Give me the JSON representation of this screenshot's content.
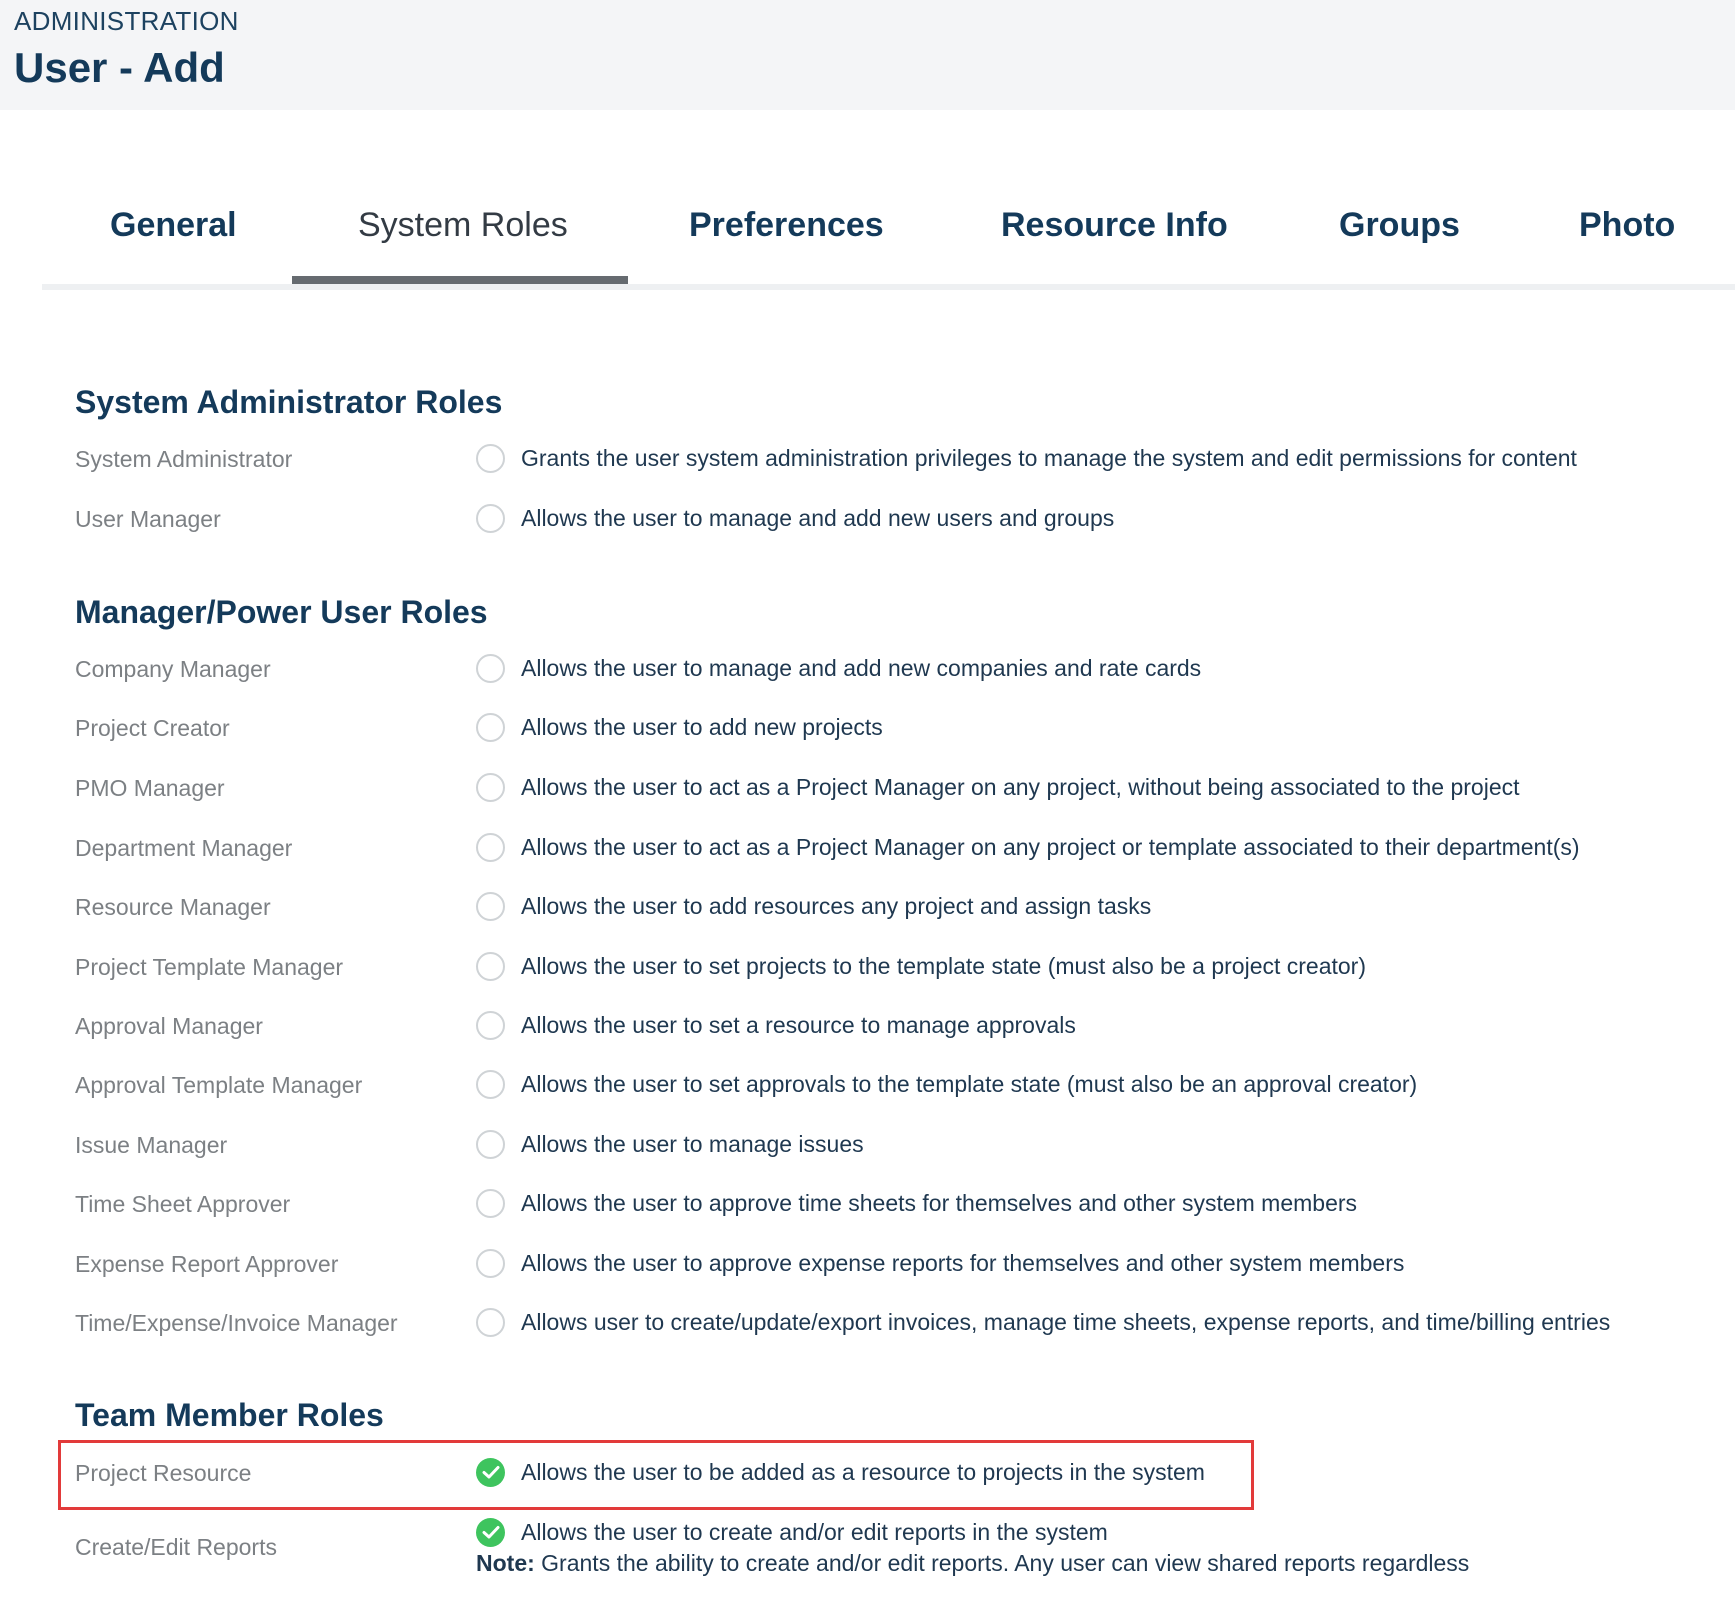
{
  "header": {
    "breadcrumb": "ADMINISTRATION",
    "title": "User - Add"
  },
  "tabs": [
    {
      "label": "General",
      "active": false
    },
    {
      "label": "System Roles",
      "active": true
    },
    {
      "label": "Preferences",
      "active": false
    },
    {
      "label": "Resource Info",
      "active": false
    },
    {
      "label": "Groups",
      "active": false
    },
    {
      "label": "Photo",
      "active": false
    }
  ],
  "sections": {
    "admin": {
      "title": "System Administrator Roles",
      "roles": [
        {
          "label": "System Administrator",
          "description": "Grants the user system administration privileges to manage the system and edit permissions for content",
          "checked": false
        },
        {
          "label": "User Manager",
          "description": "Allows the user to manage and add new users and groups",
          "checked": false
        }
      ]
    },
    "manager": {
      "title": "Manager/Power User Roles",
      "roles": [
        {
          "label": "Company Manager",
          "description": "Allows the user to manage and add new companies and rate cards",
          "checked": false
        },
        {
          "label": "Project Creator",
          "description": "Allows the user to add new projects",
          "checked": false
        },
        {
          "label": "PMO Manager",
          "description": "Allows the user to act as a Project Manager on any project, without being associated to the project",
          "checked": false
        },
        {
          "label": "Department Manager",
          "description": "Allows the user to act as a Project Manager on any project or template associated to their department(s)",
          "checked": false
        },
        {
          "label": "Resource Manager",
          "description": "Allows the user to add resources any project and assign tasks",
          "checked": false
        },
        {
          "label": "Project Template Manager",
          "description": "Allows the user to set projects to the template state (must also be a project creator)",
          "checked": false
        },
        {
          "label": "Approval Manager",
          "description": "Allows the user to set a resource to manage approvals",
          "checked": false
        },
        {
          "label": "Approval Template Manager",
          "description": "Allows the user to set approvals to the template state (must also be an approval creator)",
          "checked": false
        },
        {
          "label": "Issue Manager",
          "description": "Allows the user to manage issues",
          "checked": false
        },
        {
          "label": "Time Sheet Approver",
          "description": "Allows the user to approve time sheets for themselves and other system members",
          "checked": false
        },
        {
          "label": "Expense Report Approver",
          "description": "Allows the user to approve expense reports for themselves and other system members",
          "checked": false
        },
        {
          "label": "Time/Expense/Invoice Manager",
          "description": "Allows user to create/update/export invoices, manage time sheets, expense reports, and time/billing entries",
          "checked": false
        }
      ]
    },
    "team": {
      "title": "Team Member Roles",
      "roles": [
        {
          "label": "Project Resource",
          "description": "Allows the user to be added as a resource to projects in the system",
          "checked": true
        },
        {
          "label": "Create/Edit Reports",
          "description": "Allows the user to create and/or edit reports in the system",
          "checked": true,
          "note_label": "Note:",
          "note_text": " Grants the ability to create and/or edit reports. Any user can view shared reports regardless"
        }
      ]
    }
  },
  "colors": {
    "highlight": "#e23a3a",
    "checked": "#3ec45e",
    "title": "#143a5a"
  }
}
